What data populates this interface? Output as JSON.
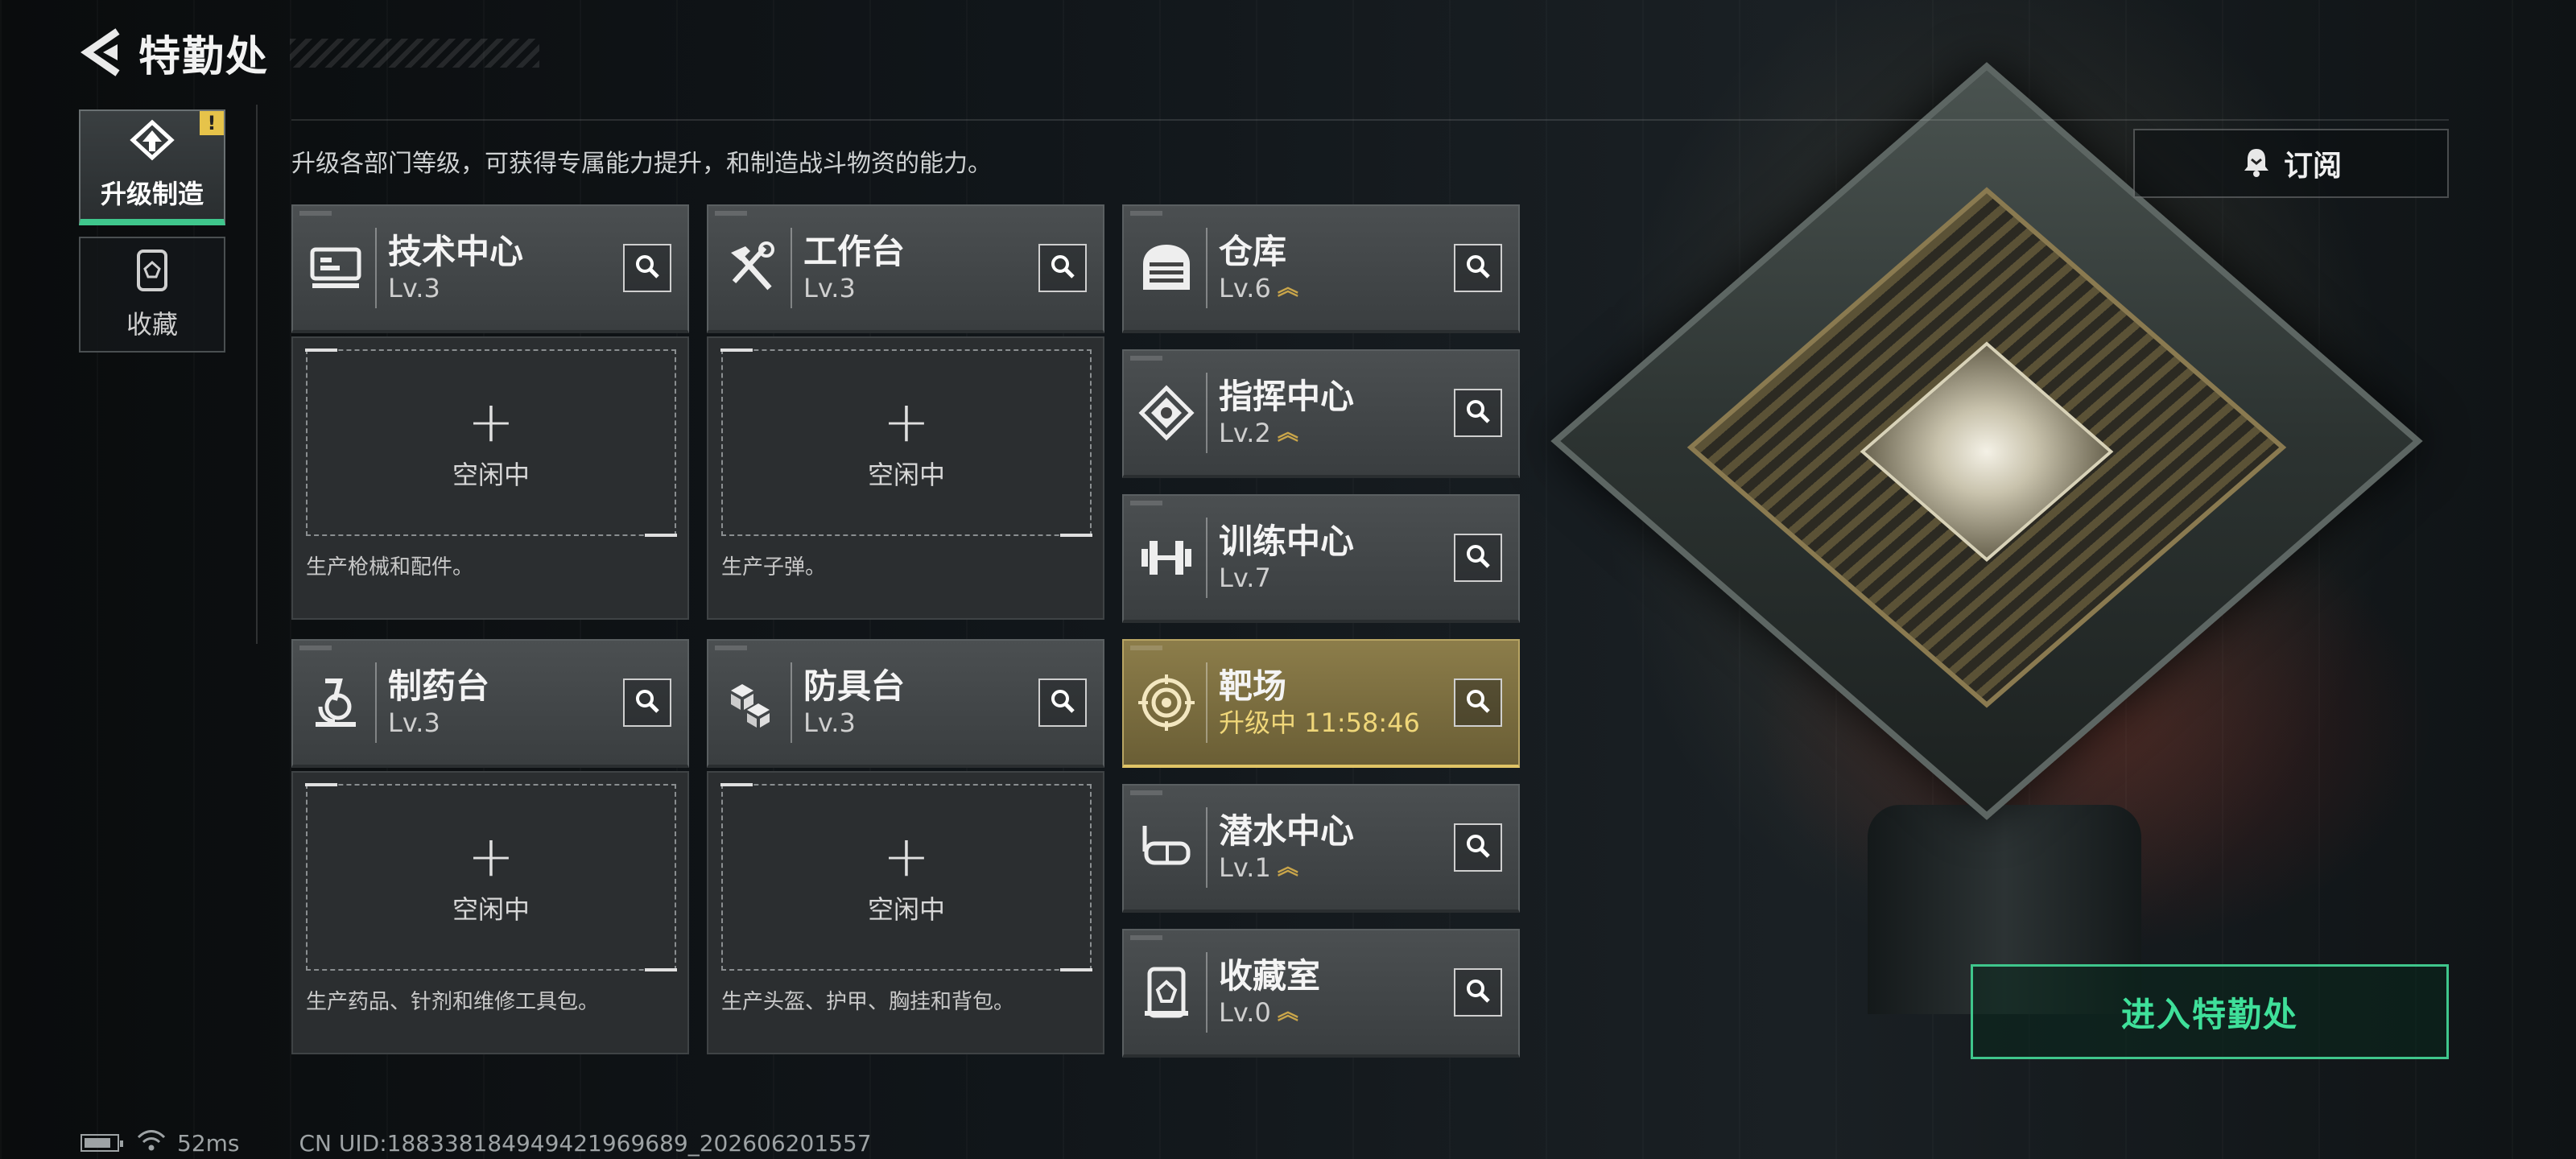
{
  "header": {
    "title": "特勤处"
  },
  "side_nav": [
    {
      "label": "升级制造",
      "active": true,
      "badge": "!"
    },
    {
      "label": "收藏",
      "active": false
    }
  ],
  "description": "升级各部门等级，可获得专属能力提升，和制造战斗物资的能力。",
  "subscribe": {
    "label": "订阅"
  },
  "facilities": {
    "tech_center": {
      "name": "技术中心",
      "level": "Lv.3"
    },
    "workbench": {
      "name": "工作台",
      "level": "Lv.3"
    },
    "pharmacy": {
      "name": "制药台",
      "level": "Lv.3"
    },
    "armor_bench": {
      "name": "防具台",
      "level": "Lv.3"
    },
    "warehouse": {
      "name": "仓库",
      "level": "Lv.6"
    },
    "command_center": {
      "name": "指挥中心",
      "level": "Lv.2"
    },
    "training_center": {
      "name": "训练中心",
      "level": "Lv.7"
    },
    "shooting_range": {
      "name": "靶场",
      "status": "升级中 11:58:46"
    },
    "diving_center": {
      "name": "潜水中心",
      "level": "Lv.1"
    },
    "collection_room": {
      "name": "收藏室",
      "level": "Lv.0"
    }
  },
  "slots": {
    "tech_center": {
      "idle": "空闲中",
      "desc": "生产枪械和配件。"
    },
    "workbench": {
      "idle": "空闲中",
      "desc": "生产子弹。"
    },
    "pharmacy": {
      "idle": "空闲中",
      "desc": "生产药品、针剂和维修工具包。"
    },
    "armor_bench": {
      "idle": "空闲中",
      "desc": "生产头盔、护甲、胸挂和背包。"
    }
  },
  "enter_button": {
    "label": "进入特勤处"
  },
  "footer": {
    "ping": "52ms",
    "uid": "CN UID:188338184949421969689_202606201557"
  },
  "colors": {
    "accent_green": "#3fc68c",
    "upgrade_gold": "#e0c466",
    "warning_yellow": "#e6c34a"
  }
}
